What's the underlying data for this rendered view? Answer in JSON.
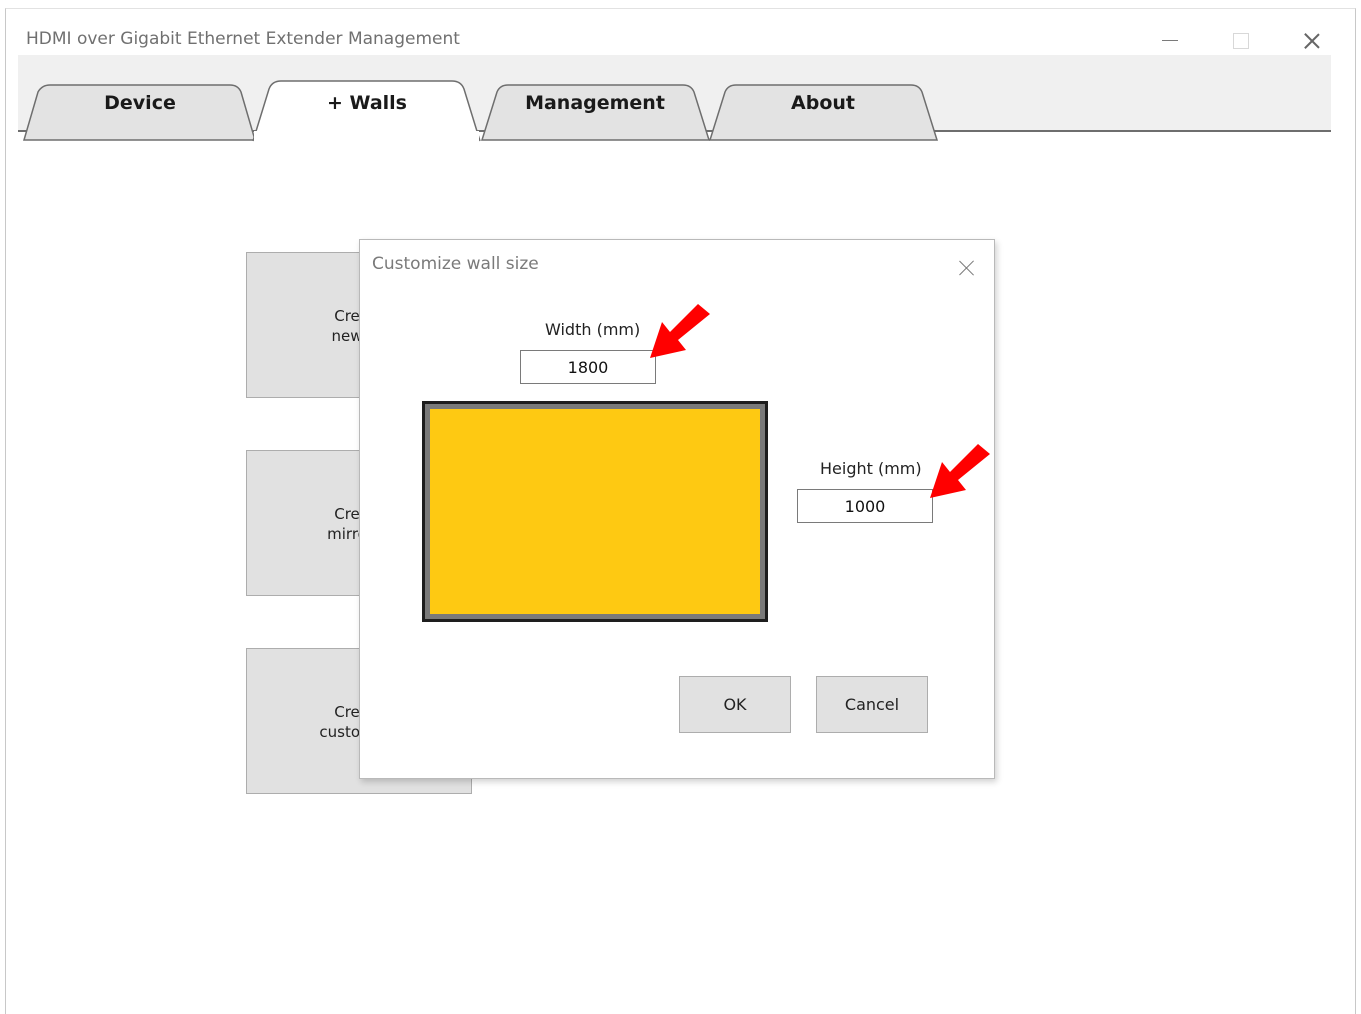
{
  "window": {
    "title": "HDMI over Gigabit Ethernet Extender Management"
  },
  "tabs": [
    {
      "label": "Device",
      "selected": false
    },
    {
      "label": "+ Walls",
      "selected": true
    },
    {
      "label": "Management",
      "selected": false
    },
    {
      "label": "About",
      "selected": false
    }
  ],
  "content_buttons": [
    {
      "line1": "Cre",
      "line2": "new"
    },
    {
      "line1": "Cre",
      "line2": "mirro"
    },
    {
      "line1": "Cre",
      "line2": "custom"
    }
  ],
  "dialog": {
    "title": "Customize wall size",
    "width_label": "Width (mm)",
    "width_value": "1800",
    "height_label": "Height (mm)",
    "height_value": "1000",
    "ok_label": "OK",
    "cancel_label": "Cancel"
  },
  "colors": {
    "wall_fill": "#fec912",
    "annotation_arrow": "#ff0000"
  }
}
